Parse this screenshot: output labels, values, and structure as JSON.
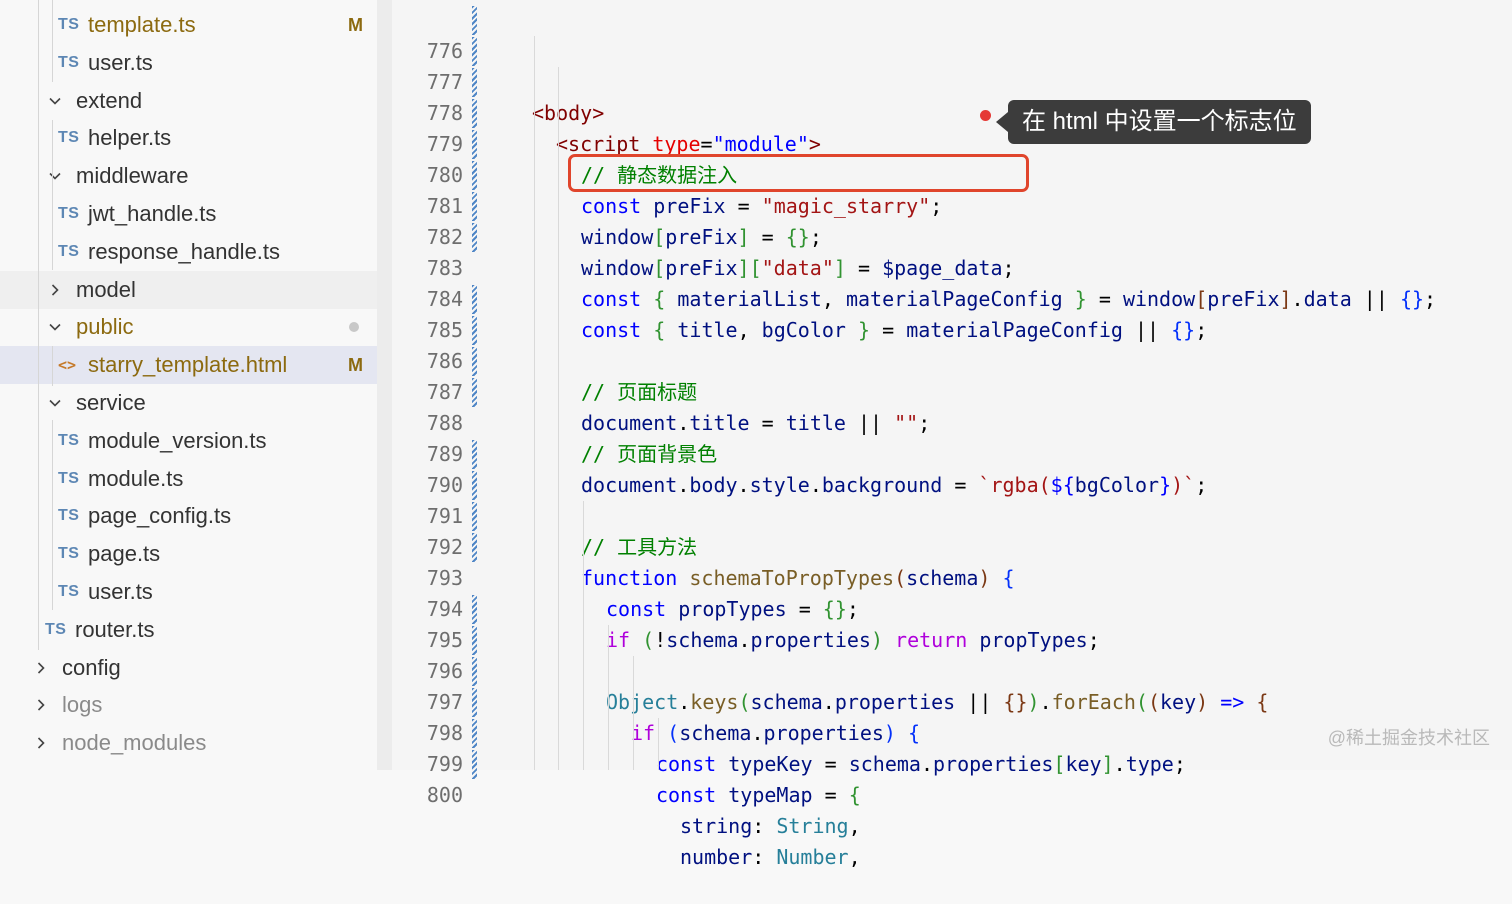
{
  "explorer": {
    "items": [
      {
        "type": "ts",
        "name": "template.ts",
        "status": "M",
        "modified": true
      },
      {
        "type": "ts",
        "name": "user.ts"
      },
      {
        "type": "folder",
        "name": "extend",
        "open": true
      },
      {
        "type": "ts",
        "name": "helper.ts"
      },
      {
        "type": "folder",
        "name": "middleware",
        "open": true
      },
      {
        "type": "ts",
        "name": "jwt_handle.ts"
      },
      {
        "type": "ts",
        "name": "response_handle.ts"
      },
      {
        "type": "folder",
        "name": "model",
        "open": false
      },
      {
        "type": "folder",
        "name": "public",
        "open": true,
        "dot": true
      },
      {
        "type": "html",
        "name": "starry_template.html",
        "status": "M",
        "modified": true
      },
      {
        "type": "folder",
        "name": "service",
        "open": true
      },
      {
        "type": "ts",
        "name": "module_version.ts"
      },
      {
        "type": "ts",
        "name": "module.ts"
      },
      {
        "type": "ts",
        "name": "page_config.ts"
      },
      {
        "type": "ts",
        "name": "page.ts"
      },
      {
        "type": "ts",
        "name": "user.ts"
      },
      {
        "type": "ts",
        "name": "router.ts"
      },
      {
        "type": "folder",
        "name": "config",
        "open": false
      },
      {
        "type": "folder",
        "name": "logs",
        "open": false,
        "dim": true
      },
      {
        "type": "folder",
        "name": "node_modules",
        "open": false,
        "dim": true
      }
    ],
    "ts_label": "TS",
    "html_label": "<>"
  },
  "editor": {
    "line_numbers": [
      "776",
      "777",
      "778",
      "779",
      "780",
      "781",
      "782",
      "783",
      "784",
      "785",
      "786",
      "787",
      "788",
      "789",
      "790",
      "791",
      "792",
      "793",
      "794",
      "795",
      "796",
      "797",
      "798",
      "799",
      "800"
    ]
  },
  "annotation": {
    "tooltip": "在 html 中设置一个标志位",
    "highlight_color": "#e0452c"
  },
  "watermark": "@稀土掘金技术社区",
  "colors": {
    "keyword": "#0000ff",
    "string": "#a31515",
    "comment": "#008000",
    "variable": "#001080",
    "function": "#795e26",
    "control": "#af00db"
  }
}
